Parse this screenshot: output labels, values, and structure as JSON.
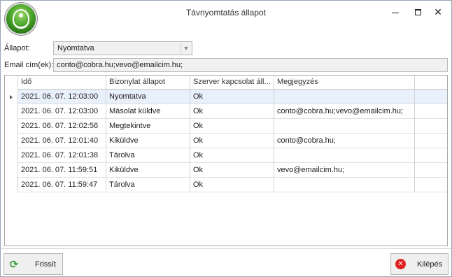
{
  "window": {
    "title": "Távnyomtatás állapot",
    "close_glyph": "✕"
  },
  "form": {
    "status_label": "Állapot:",
    "status_value": "Nyomtatva",
    "email_label": "Email cím(ek):",
    "email_value": "conto@cobra.hu;vevo@emailcim.hu;"
  },
  "grid": {
    "columns": [
      "Idő",
      "Bizonylat állapot",
      "Szerver kapcsolat áll...",
      "Megjegyzés"
    ],
    "rows": [
      {
        "time": "2021. 06. 07. 12:03:00",
        "status": "Nyomtatva",
        "server": "Ok",
        "note": ""
      },
      {
        "time": "2021. 06. 07. 12:03:00",
        "status": "Másolat küldve",
        "server": "Ok",
        "note": "conto@cobra.hu;vevo@emailcim.hu;"
      },
      {
        "time": "2021. 06. 07. 12:02:56",
        "status": "Megtekintve",
        "server": "Ok",
        "note": ""
      },
      {
        "time": "2021. 06. 07. 12:01:40",
        "status": "Kiküldve",
        "server": "Ok",
        "note": "conto@cobra.hu;"
      },
      {
        "time": "2021. 06. 07. 12:01:38",
        "status": "Tárolva",
        "server": "Ok",
        "note": ""
      },
      {
        "time": "2021. 06. 07. 11:59:51",
        "status": "Kiküldve",
        "server": "Ok",
        "note": "vevo@emailcim.hu;"
      },
      {
        "time": "2021. 06. 07. 11:59:47",
        "status": "Tárolva",
        "server": "Ok",
        "note": ""
      }
    ]
  },
  "buttons": {
    "refresh_label": "Frissít",
    "exit_label": "Kilépés"
  },
  "icons": {
    "logo": "app-logo-icon",
    "refresh": "refresh-icon",
    "exit": "exit-icon"
  },
  "colors": {
    "selected_row": "#e8f0fb",
    "logo_green": "#4aa62a",
    "exit_red": "#e02020"
  }
}
